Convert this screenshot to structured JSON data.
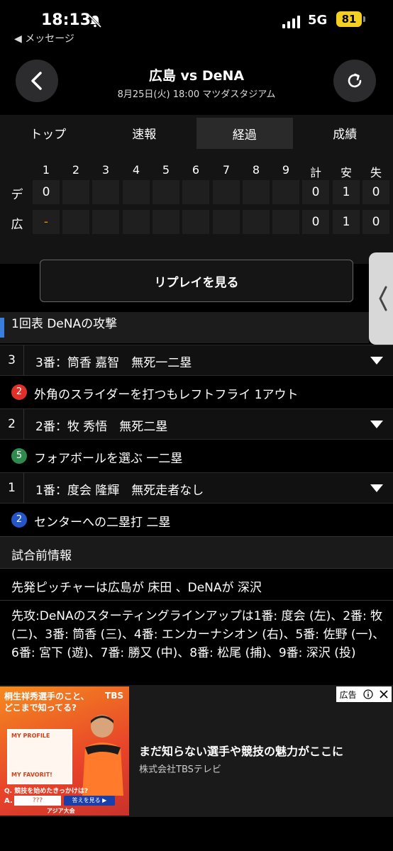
{
  "status": {
    "time": "18:13",
    "back_app": "◀ メッセージ",
    "network": "5G",
    "battery": "81"
  },
  "header": {
    "title": "広島 vs DeNA",
    "subtitle": "8月25日(火) 18:00 マツダスタジアム"
  },
  "tabs": [
    {
      "label": "トップ",
      "active": false
    },
    {
      "label": "速報",
      "active": false
    },
    {
      "label": "経過",
      "active": true
    },
    {
      "label": "成績",
      "active": false
    }
  ],
  "scoreboard": {
    "innings": [
      "1",
      "2",
      "3",
      "4",
      "5",
      "6",
      "7",
      "8",
      "9"
    ],
    "totals_headers": [
      "計",
      "安",
      "失"
    ],
    "rows": [
      {
        "team": "デ",
        "innings": [
          "0",
          "",
          "",
          "",
          "",
          "",
          "",
          "",
          ""
        ],
        "totals": [
          "0",
          "1",
          "0"
        ]
      },
      {
        "team": "広",
        "innings": [
          "-",
          "",
          "",
          "",
          "",
          "",
          "",
          "",
          ""
        ],
        "totals": [
          "0",
          "1",
          "0"
        ]
      }
    ]
  },
  "replay_button": "リプレイを見る",
  "inning_header": "1回表 DeNAの攻撃",
  "plays": [
    {
      "order": "3",
      "batter": "3番：筒香 嘉智　無死一二塁",
      "badge": "2",
      "badge_color": "#e0302a",
      "result": "外角のスライダーを打つもレフトフライ 1アウト"
    },
    {
      "order": "2",
      "batter": "2番：牧 秀悟　無死二塁",
      "badge": "5",
      "badge_color": "#2f8a4e",
      "result": "フォアボールを選ぶ 一二塁"
    },
    {
      "order": "1",
      "batter": "1番：度会 隆輝　無死走者なし",
      "badge": "2",
      "badge_color": "#2456c7",
      "result": "センターへの二塁打 二塁"
    }
  ],
  "pregame": {
    "title": "試合前情報",
    "pitchers": "先発ピッチャーは広島が 床田 、DeNAが 深沢",
    "lineup": "先攻:DeNAのスターティングラインアップは1番: 度会 (左)、2番: 牧 (二)、3番: 筒香 (三)、4番: エンカーナシオン (右)、5番: 佐野 (一)、6番: 宮下 (遊)、7番: 勝又 (中)、8番: 松尾 (捕)、9番: 深沢 (投)"
  },
  "ad": {
    "label": "広告",
    "thumb_headline": "桐生祥秀選手のこと、どこまで知ってる?",
    "thumb_brand": "TBS",
    "thumb_card_1": "MY PROFILE",
    "thumb_card_2": "MY FAVORIT!",
    "thumb_question": "Q. 競技を始めたきっかけは?",
    "thumb_answer_label": "A.",
    "thumb_answer_box": "???",
    "thumb_answer_button": "答えを見る ▶",
    "thumb_logo": "アジア大会",
    "headline": "まだ知らない選手や競技の魅力がここに",
    "sponsor": "株式会社TBSテレビ"
  }
}
